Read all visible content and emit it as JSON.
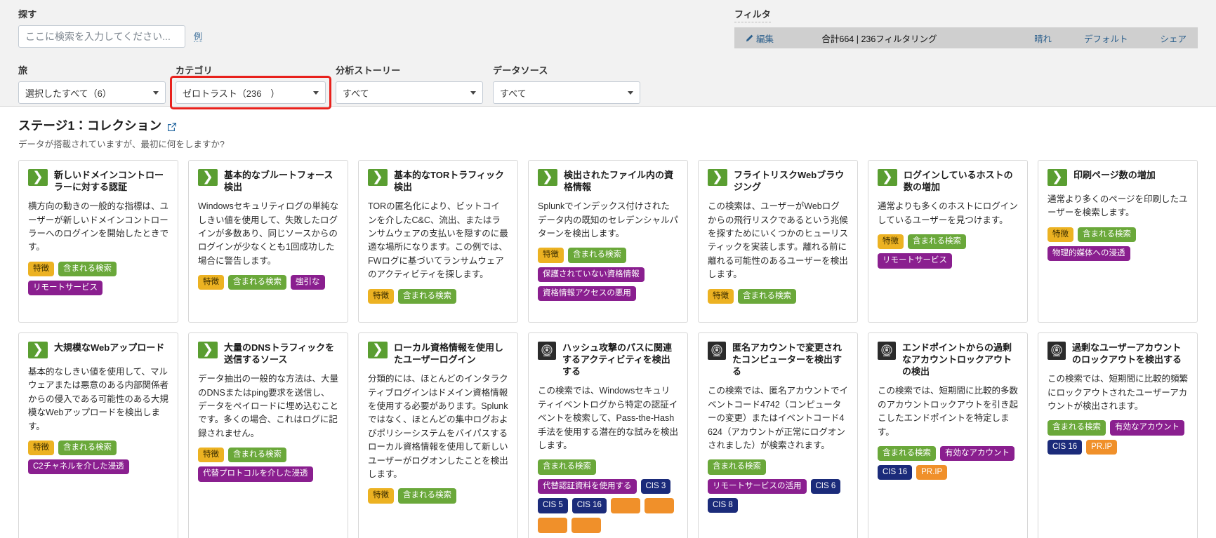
{
  "search": {
    "label": "探す",
    "placeholder": "ここに検索を入力してください...",
    "value": "",
    "example_link": "例"
  },
  "filters_summary": {
    "title": "フィルタ",
    "edit": "編集",
    "count_text": "合計664 | 236フィルタリング",
    "clear": "晴れ",
    "default": "デフォルト",
    "share": "シェア"
  },
  "selects": [
    {
      "label": "旅",
      "value": "選択したすべて（6）",
      "highlighted": false
    },
    {
      "label": "カテゴリ",
      "value": "ゼロトラスト（236　）",
      "highlighted": true
    },
    {
      "label": "分析ストーリー",
      "value": "すべて",
      "highlighted": false
    },
    {
      "label": "データソース",
      "value": "すべて",
      "highlighted": false
    }
  ],
  "stage": {
    "title": "ステージ1：コレクション",
    "subtitle": "データが搭載されていますが、最初に何をしますか?"
  },
  "cards": [
    {
      "icon": "chevron-green",
      "title": "新しいドメインコントローラーに対する認証",
      "desc": "横方向の動きの一般的な指標は、ユーザーが新しいドメインコントローラーへのログインを開始したときです。",
      "tags": [
        {
          "text": "特徴",
          "color": "yellow"
        },
        {
          "text": "含まれる検索",
          "color": "green"
        },
        {
          "text": "リモートサービス",
          "color": "purple"
        }
      ]
    },
    {
      "icon": "chevron-green",
      "title": "基本的なブルートフォース検出",
      "desc": "Windowsセキュリティログの単純なしきい値を使用して、失敗したログインが多数あり、同じソースからのログインが少なくとも1回成功した場合に警告します。",
      "tags": [
        {
          "text": "特徴",
          "color": "yellow"
        },
        {
          "text": "含まれる検索",
          "color": "green"
        },
        {
          "text": "強引な",
          "color": "purple"
        }
      ]
    },
    {
      "icon": "chevron-green",
      "title": "基本的なTORトラフィック検出",
      "desc": "TORの匿名化により、ビットコインを介したC&C、流出、またはランサムウェアの支払いを隠すのに最適な場所になります。この例では、FWログに基づいてランサムウェアのアクティビティを探します。",
      "tags": [
        {
          "text": "特徴",
          "color": "yellow"
        },
        {
          "text": "含まれる検索",
          "color": "green"
        }
      ]
    },
    {
      "icon": "chevron-green",
      "title": "検出されたファイル内の資格情報",
      "desc": "Splunkでインデックス付けされたデータ内の既知のセレデンシャルパターンを検出します。",
      "tags": [
        {
          "text": "特徴",
          "color": "yellow"
        },
        {
          "text": "含まれる検索",
          "color": "green"
        },
        {
          "text": "保護されていない資格情報",
          "color": "purple"
        },
        {
          "text": "資格情報アクセスの悪用",
          "color": "purple"
        }
      ]
    },
    {
      "icon": "chevron-green",
      "title": "フライトリスクWebブラウジング",
      "desc": "この検索は、ユーザーがWebログからの飛行リスクであるという兆候を探すためにいくつかのヒューリスティックを実装します。離れる前に離れる可能性のあるユーザーを検出します。",
      "tags": [
        {
          "text": "特徴",
          "color": "yellow"
        },
        {
          "text": "含まれる検索",
          "color": "green"
        }
      ]
    },
    {
      "icon": "chevron-green",
      "title": "ログインしているホストの数の増加",
      "desc": "通常よりも多くのホストにログインしているユーザーを見つけます。",
      "tags": [
        {
          "text": "特徴",
          "color": "yellow"
        },
        {
          "text": "含まれる検索",
          "color": "green"
        },
        {
          "text": "リモートサービス",
          "color": "purple"
        }
      ]
    },
    {
      "icon": "chevron-green",
      "title": "印刷ページ数の増加",
      "desc": "通常より多くのページを印刷したユーザーを検索します。",
      "tags": [
        {
          "text": "特徴",
          "color": "yellow"
        },
        {
          "text": "含まれる検索",
          "color": "green"
        },
        {
          "text": "物理的媒体への浸透",
          "color": "purple"
        }
      ]
    },
    {
      "icon": "chevron-green",
      "title": "大規模なWebアップロード",
      "desc": "基本的なしきい値を使用して、マルウェアまたは悪意のある内部関係者からの侵入である可能性のある大規模なWebアップロードを検出します。",
      "tags": [
        {
          "text": "特徴",
          "color": "yellow"
        },
        {
          "text": "含まれる検索",
          "color": "green"
        },
        {
          "text": "C2チャネルを介した浸透",
          "color": "purple"
        }
      ]
    },
    {
      "icon": "chevron-green",
      "title": "大量のDNSトラフィックを送信するソース",
      "desc": "データ抽出の一般的な方法は、大量のDNSまたはping要求を送信し、データをペイロードに埋め込むことです。多くの場合、これはログに記録されません。",
      "tags": [
        {
          "text": "特徴",
          "color": "yellow"
        },
        {
          "text": "含まれる検索",
          "color": "green"
        },
        {
          "text": "代替プロトコルを介した浸透",
          "color": "purple"
        }
      ]
    },
    {
      "icon": "chevron-green",
      "title": "ローカル資格情報を使用したユーザーログイン",
      "desc": "分類的には、ほとんどのインタラクティブログインはドメイン資格情報を使用する必要があります。Splunkではなく、ほとんどの集中ログおよびポリシーシステムをバイパスするローカル資格情報を使用して新しいユーザーがログオンしたことを検出します。",
      "tags": [
        {
          "text": "特徴",
          "color": "yellow"
        },
        {
          "text": "含まれる検索",
          "color": "green"
        }
      ]
    },
    {
      "icon": "seal-dark",
      "title": "ハッシュ攻撃のパスに関連するアクティビティを検出する",
      "desc": "この検索では、Windowsセキュリティイベントログから特定の認証イベントを検索して、Pass-the-Hash手法を使用する潜在的な試みを検出します。",
      "tags": [
        {
          "text": "含まれる検索",
          "color": "green"
        },
        {
          "text": "代替認証資料を使用する",
          "color": "purple"
        },
        {
          "text": "CIS 3",
          "color": "navy"
        },
        {
          "text": "CIS 5",
          "color": "navy"
        },
        {
          "text": "CIS 16",
          "color": "navy"
        },
        {
          "text": "",
          "color": "orange"
        },
        {
          "text": "",
          "color": "orange"
        },
        {
          "text": "",
          "color": "orange"
        },
        {
          "text": "",
          "color": "orange"
        }
      ]
    },
    {
      "icon": "seal-dark",
      "title": "匿名アカウントで変更されたコンピューターを検出する",
      "desc": "この検索では、匿名アカウントでイベントコード4742（コンピューターの変更）またはイベントコード4624（アカウントが正常にログオンされました）が検索されます。",
      "tags": [
        {
          "text": "含まれる検索",
          "color": "green"
        },
        {
          "text": "リモートサービスの活用",
          "color": "purple"
        },
        {
          "text": "CIS 6",
          "color": "navy"
        },
        {
          "text": "CIS 8",
          "color": "navy"
        }
      ]
    },
    {
      "icon": "seal-dark",
      "title": "エンドポイントからの過剰なアカウントロックアウトの検出",
      "desc": "この検索では、短期間に比較的多数のアカウントロックアウトを引き起こしたエンドポイントを特定します。",
      "tags": [
        {
          "text": "含まれる検索",
          "color": "green"
        },
        {
          "text": "有効なアカウント",
          "color": "purple"
        },
        {
          "text": "CIS 16",
          "color": "navy"
        },
        {
          "text": "PR.IP",
          "color": "orange"
        }
      ]
    },
    {
      "icon": "seal-dark",
      "title": "過剰なユーザーアカウントのロックアウトを検出する",
      "desc": "この検索では、短期間に比較的頻繁にロックアウトされたユーザーアカウントが検出されます。",
      "tags": [
        {
          "text": "含まれる検索",
          "color": "green"
        },
        {
          "text": "有効なアカウント",
          "color": "purple"
        },
        {
          "text": "CIS 16",
          "color": "navy"
        },
        {
          "text": "PR.IP",
          "color": "orange"
        }
      ]
    }
  ]
}
